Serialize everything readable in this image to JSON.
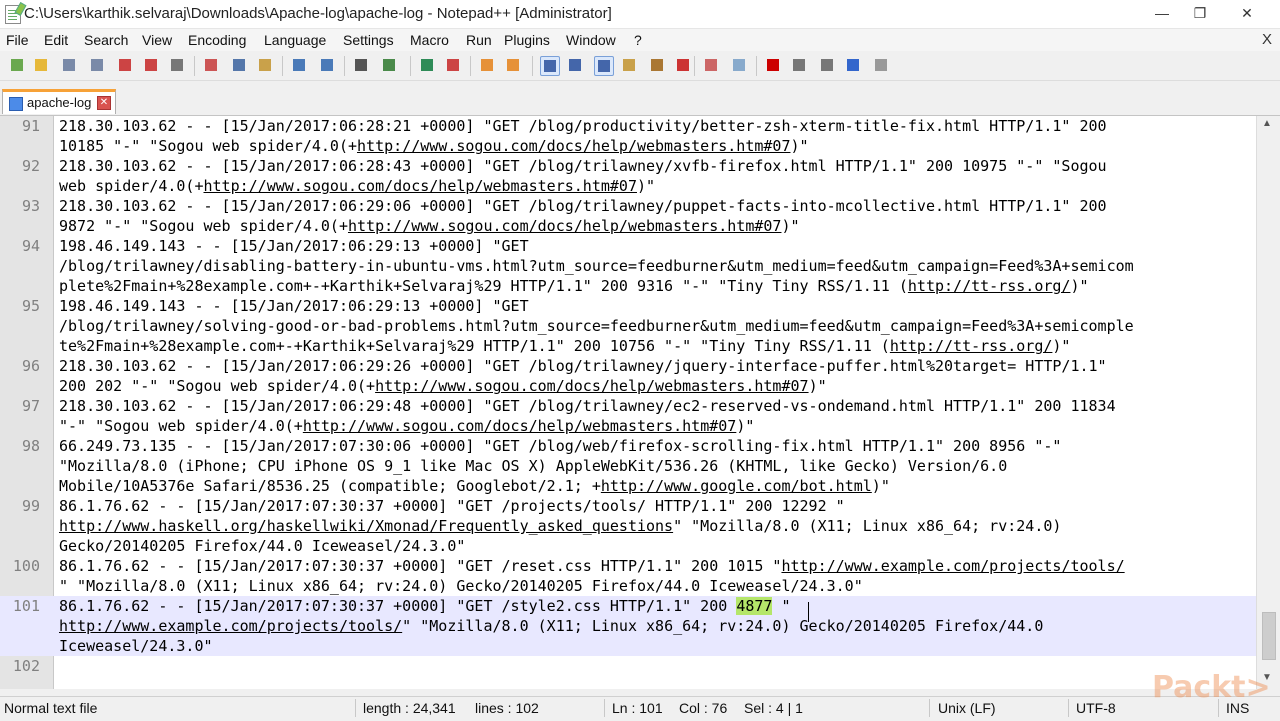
{
  "window": {
    "title": "C:\\Users\\karthik.selvaraj\\Downloads\\Apache-log\\apache-log - Notepad++ [Administrator]",
    "controls": {
      "minimize": "—",
      "maximize": "❐",
      "close": "✕"
    }
  },
  "menu": {
    "items": [
      "File",
      "Edit",
      "Search",
      "View",
      "Encoding",
      "Language",
      "Settings",
      "Macro",
      "Run",
      "Plugins",
      "Window",
      "?"
    ],
    "close": "X"
  },
  "toolbar": {
    "icons": [
      "new-file-icon",
      "open-file-icon",
      "save-icon",
      "save-all-icon",
      "close-icon",
      "close-all-icon",
      "print-icon",
      "cut-icon",
      "copy-icon",
      "paste-icon",
      "undo-icon",
      "redo-icon",
      "find-icon",
      "replace-icon",
      "zoom-in-icon",
      "zoom-out-icon",
      "sync-vertical-icon",
      "sync-horizontal-icon",
      "word-wrap-icon",
      "show-all-chars-icon",
      "indent-guide-icon",
      "user-defined-language-icon",
      "document-map-icon",
      "function-list-icon",
      "folder-as-workspace-icon",
      "monitoring-icon",
      "record-macro-icon",
      "stop-recording-icon",
      "playback-macro-icon",
      "run-macro-multiple-icon",
      "save-macro-icon"
    ]
  },
  "tab": {
    "label": "apache-log",
    "close": "✕"
  },
  "editor": {
    "lines": [
      {
        "num": "91",
        "rows": [
          [
            "218.30.103.62 - - [15/Jan/2017:06:28:21 +0000] \"GET /blog/productivity/better-zsh-xterm-title-fix.html HTTP/1.1\" 200"
          ],
          [
            "10185 \"-\" \"Sogou web spider/4.0(+",
            {
              "u": "http://www.sogou.com/docs/help/webmasters.htm#07"
            },
            ")\""
          ]
        ]
      },
      {
        "num": "92",
        "rows": [
          [
            "218.30.103.62 - - [15/Jan/2017:06:28:43 +0000] \"GET /blog/trilawney/xvfb-firefox.html HTTP/1.1\" 200 10975 \"-\" \"Sogou"
          ],
          [
            "web spider/4.0(+",
            {
              "u": "http://www.sogou.com/docs/help/webmasters.htm#07"
            },
            ")\""
          ]
        ]
      },
      {
        "num": "93",
        "rows": [
          [
            "218.30.103.62 - - [15/Jan/2017:06:29:06 +0000] \"GET /blog/trilawney/puppet-facts-into-mcollective.html HTTP/1.1\" 200"
          ],
          [
            "9872 \"-\" \"Sogou web spider/4.0(+",
            {
              "u": "http://www.sogou.com/docs/help/webmasters.htm#07"
            },
            ")\""
          ]
        ]
      },
      {
        "num": "94",
        "rows": [
          [
            "198.46.149.143 - - [15/Jan/2017:06:29:13 +0000] \"GET"
          ],
          [
            "/blog/trilawney/disabling-battery-in-ubuntu-vms.html?utm_source=feedburner&utm_medium=feed&utm_campaign=Feed%3A+semicom"
          ],
          [
            "plete%2Fmain+%28example.com+-+Karthik+Selvaraj%29 HTTP/1.1\" 200 9316 \"-\" \"Tiny Tiny RSS/1.11 (",
            {
              "u": "http://tt-rss.org/"
            },
            ")\""
          ]
        ]
      },
      {
        "num": "95",
        "rows": [
          [
            "198.46.149.143 - - [15/Jan/2017:06:29:13 +0000] \"GET"
          ],
          [
            "/blog/trilawney/solving-good-or-bad-problems.html?utm_source=feedburner&utm_medium=feed&utm_campaign=Feed%3A+semicomple"
          ],
          [
            "te%2Fmain+%28example.com+-+Karthik+Selvaraj%29 HTTP/1.1\" 200 10756 \"-\" \"Tiny Tiny RSS/1.11 (",
            {
              "u": "http://tt-rss.org/"
            },
            ")\""
          ]
        ]
      },
      {
        "num": "96",
        "rows": [
          [
            "218.30.103.62 - - [15/Jan/2017:06:29:26 +0000] \"GET /blog/trilawney/jquery-interface-puffer.html%20target= HTTP/1.1\""
          ],
          [
            "200 202 \"-\" \"Sogou web spider/4.0(+",
            {
              "u": "http://www.sogou.com/docs/help/webmasters.htm#07"
            },
            ")\""
          ]
        ]
      },
      {
        "num": "97",
        "rows": [
          [
            "218.30.103.62 - - [15/Jan/2017:06:29:48 +0000] \"GET /blog/trilawney/ec2-reserved-vs-ondemand.html HTTP/1.1\" 200 11834"
          ],
          [
            "\"-\" \"Sogou web spider/4.0(+",
            {
              "u": "http://www.sogou.com/docs/help/webmasters.htm#07"
            },
            ")\""
          ]
        ]
      },
      {
        "num": "98",
        "rows": [
          [
            "66.249.73.135 - - [15/Jan/2017:07:30:06 +0000] \"GET /blog/web/firefox-scrolling-fix.html HTTP/1.1\" 200 8956 \"-\""
          ],
          [
            "\"Mozilla/8.0 (iPhone; CPU iPhone OS 9_1 like Mac OS X) AppleWebKit/536.26 (KHTML, like Gecko) Version/6.0"
          ],
          [
            "Mobile/10A5376e Safari/8536.25 (compatible; Googlebot/2.1; +",
            {
              "u": "http://www.google.com/bot.html"
            },
            ")\""
          ]
        ]
      },
      {
        "num": "99",
        "rows": [
          [
            "86.1.76.62 - - [15/Jan/2017:07:30:37 +0000] \"GET /projects/tools/ HTTP/1.1\" 200 12292 \""
          ],
          [
            {
              "u": "http://www.haskell.org/haskellwiki/Xmonad/Frequently_asked_questions"
            },
            "\" \"Mozilla/8.0 (X11; Linux x86_64; rv:24.0)"
          ],
          [
            "Gecko/20140205 Firefox/44.0 Iceweasel/24.3.0\""
          ]
        ]
      },
      {
        "num": "100",
        "rows": [
          [
            "86.1.76.62 - - [15/Jan/2017:07:30:37 +0000] \"GET /reset.css HTTP/1.1\" 200 1015 \"",
            {
              "u": "http://www.example.com/projects/tools/"
            }
          ],
          [
            "\" \"Mozilla/8.0 (X11; Linux x86_64; rv:24.0) Gecko/20140205 Firefox/44.0 Iceweasel/24.3.0\""
          ]
        ]
      },
      {
        "num": "101",
        "current": true,
        "rows": [
          [
            "86.1.76.62 - - [15/Jan/2017:07:30:37 +0000] \"GET /style2.css HTTP/1.1\" 200 ",
            {
              "s": "4877"
            },
            " \""
          ],
          [
            {
              "u": "http://www.example.com/projects/tools/"
            },
            "\" \"Mozilla/8.0 (X11; Linux x86_64; rv:24.0) Gecko/20140205 Firefox/44.0"
          ],
          [
            "Iceweasel/24.3.0\""
          ]
        ]
      },
      {
        "num": "102",
        "rows": [
          [
            ""
          ]
        ]
      }
    ]
  },
  "status": {
    "file_type": "Normal text file",
    "length": "length : 24,341",
    "lines": "lines : 102",
    "ln": "Ln : 101",
    "col": "Col : 76",
    "sel": "Sel : 4 | 1",
    "eol": "Unix (LF)",
    "encoding": "UTF-8",
    "mode": "INS"
  },
  "watermark": "Packt>",
  "colors": {
    "tab_accent": "#f7a238",
    "current_line": "#e8e8ff",
    "selection": "#b5e66a",
    "line_number": "#808080"
  }
}
